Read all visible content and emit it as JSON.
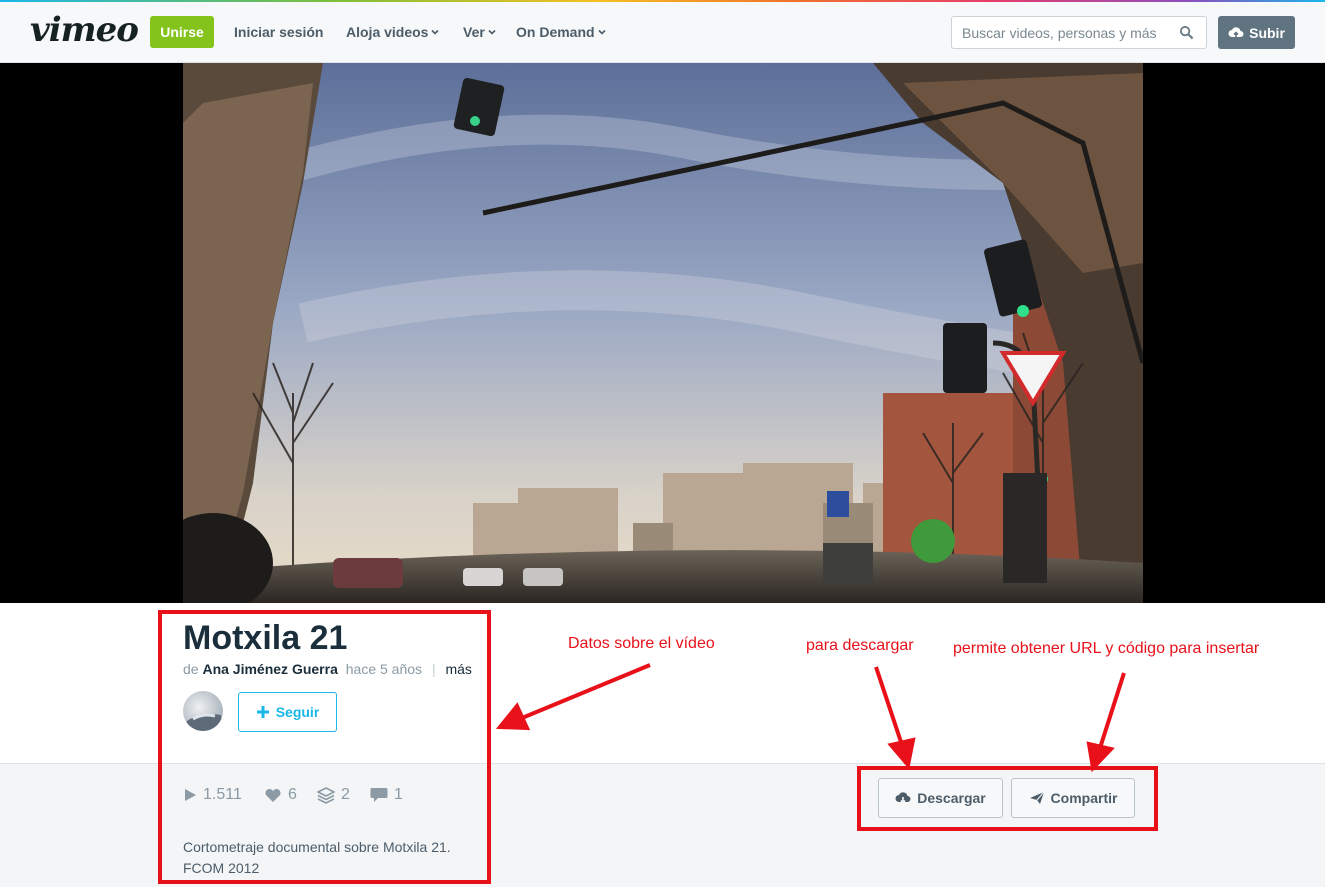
{
  "header": {
    "logo": "vimeo",
    "join_label": "Unirse",
    "login_label": "Iniciar sesión",
    "nav": [
      {
        "label": "Aloja videos"
      },
      {
        "label": "Ver"
      },
      {
        "label": "On Demand"
      }
    ],
    "search_placeholder": "Buscar videos, personas y más",
    "upload_label": "Subir"
  },
  "video": {
    "title": "Motxila 21",
    "by_prefix": "de",
    "author": "Ana Jiménez Guerra",
    "age": "hace 5 años",
    "more_label": "más",
    "follow_label": "Seguir",
    "stats": {
      "plays": "1.511",
      "likes": "6",
      "collections": "2",
      "comments": "1"
    },
    "description_line1": "Cortometraje documental sobre Motxila 21.",
    "description_line2": "FCOM 2012"
  },
  "actions": {
    "download_label": "Descargar",
    "share_label": "Compartir"
  },
  "annotations": {
    "info_note": "Datos sobre el vídeo",
    "download_note": "para descargar",
    "share_note": "permite obtener URL y código para insertar"
  },
  "colors": {
    "brand_green": "#83c31c",
    "accent_blue": "#1ab7ea",
    "annotation_red": "#e8111a"
  }
}
